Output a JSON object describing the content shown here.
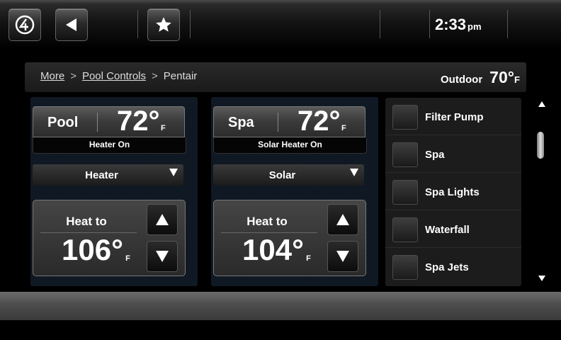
{
  "topbar": {
    "logo_icon": "crestron-logo-icon",
    "back_icon": "back-arrow-icon",
    "favorite_icon": "star-icon",
    "time": "2:33",
    "ampm": "pm"
  },
  "breadcrumb": {
    "items": [
      "More",
      "Pool Controls",
      "Pentair"
    ],
    "separator": ">"
  },
  "outdoor": {
    "label": "Outdoor",
    "value": "70°",
    "unit": "F"
  },
  "pool": {
    "name": "Pool",
    "temp": "72°",
    "unit": "F",
    "status": "Heater On",
    "mode": "Heater",
    "heat_label": "Heat to",
    "setpoint": "106°",
    "setpoint_unit": "F"
  },
  "spa": {
    "name": "Spa",
    "temp": "72°",
    "unit": "F",
    "status": "Solar Heater On",
    "mode": "Solar",
    "heat_label": "Heat to",
    "setpoint": "104°",
    "setpoint_unit": "F"
  },
  "aux_list": [
    "Filter Pump",
    "Spa",
    "Spa Lights",
    "Waterfall",
    "Spa Jets"
  ],
  "colors": {
    "background": "#000000",
    "panel": "#111b27",
    "text": "#ffffff"
  }
}
